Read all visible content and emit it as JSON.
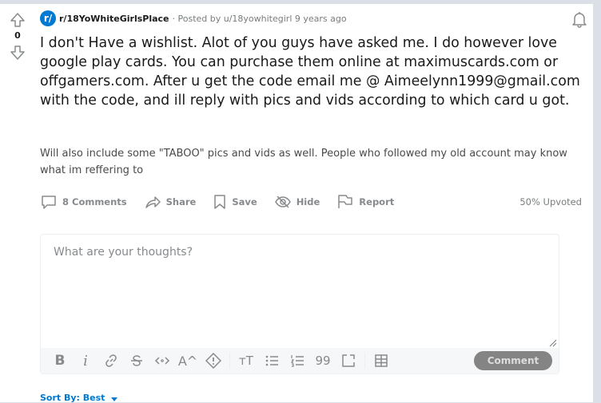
{
  "post": {
    "subreddit": "r/18YoWhiteGirlsPlace",
    "subreddit_icon": "r/",
    "meta": "· Posted by u/18yowhitegirl 9 years ago",
    "votes": "0",
    "title": "I don't Have a wishlist. Alot of you guys have asked me. I do however love google play cards. You can purchase them online at maximuscards.com or offgamers.com. After u get the code email me @ Aimeelynn1999@gmail.com with the code, and ill reply with pics and vids according to which card u got.",
    "body": "Will also include some \"TABOO\" pics and vids as well. People who followed my old account may know what im reffering to"
  },
  "actions": {
    "comments": "8 Comments",
    "share": "Share",
    "save": "Save",
    "hide": "Hide",
    "report": "Report",
    "upvoted": "50% Upvoted"
  },
  "comment_box": {
    "placeholder": "What are your thoughts?",
    "submit": "Comment",
    "tools": {
      "bold": "B",
      "italic": "i",
      "superscript": "A^",
      "heading": "тT",
      "quote": "99"
    }
  },
  "sort": {
    "label": "Sort By: Best"
  },
  "colors": {
    "accent": "#0079d3",
    "background": "#dae0e6",
    "button_disabled": "#848484"
  }
}
